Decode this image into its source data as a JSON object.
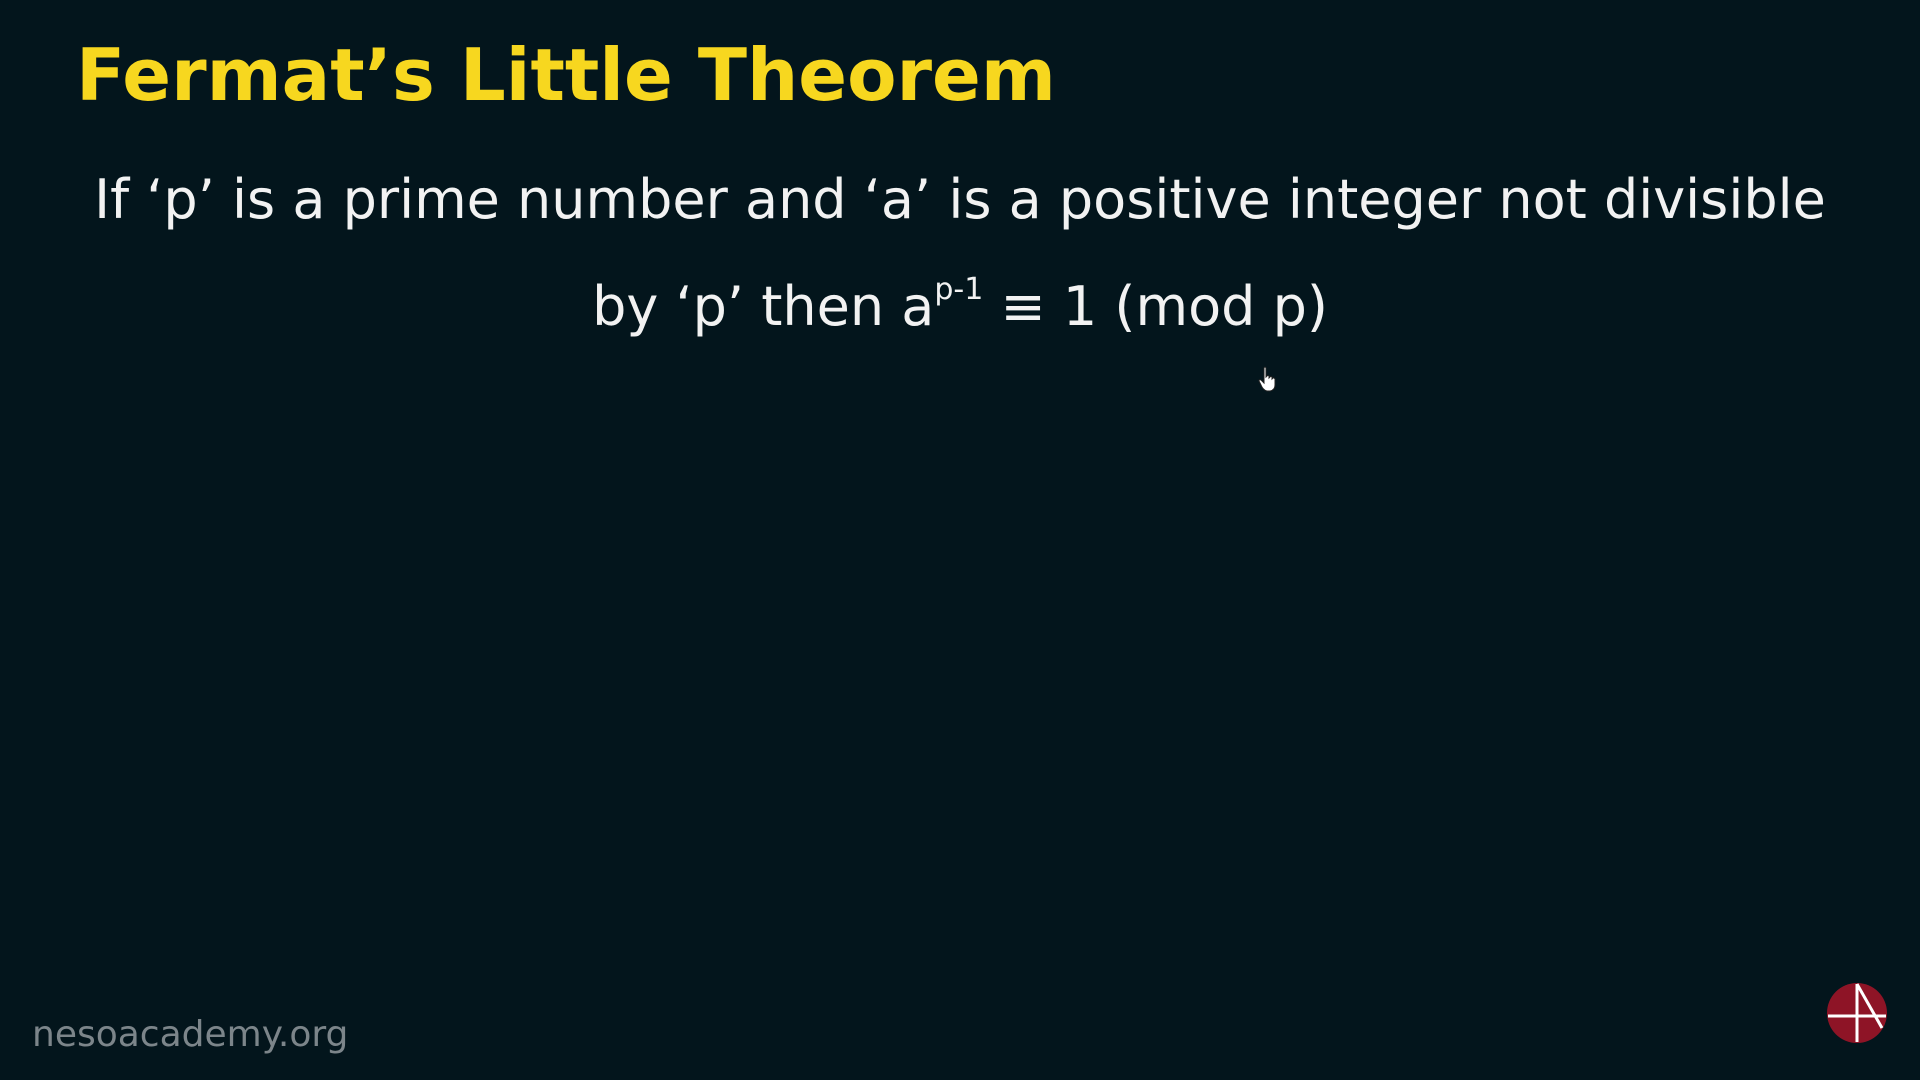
{
  "slide": {
    "title": "Fermat’s Little Theorem",
    "statement_line1": "If ‘p’ is a prime number and ‘a’ is a positive integer not divisible",
    "statement_line2_prefix": "by ‘p’ then a",
    "statement_line2_exponent": "p-1",
    "statement_line2_suffix": " ≡ 1 (mod p)",
    "watermark": "nesoacademy.org",
    "logo_icon": "neso-academy-logo-icon",
    "cursor_icon": "hand-pointer-icon"
  },
  "colors": {
    "background": "#03151c",
    "title": "#f7d71f",
    "text": "#f2f2f2",
    "watermark": "#7c858a",
    "logo": "#8e1426"
  }
}
